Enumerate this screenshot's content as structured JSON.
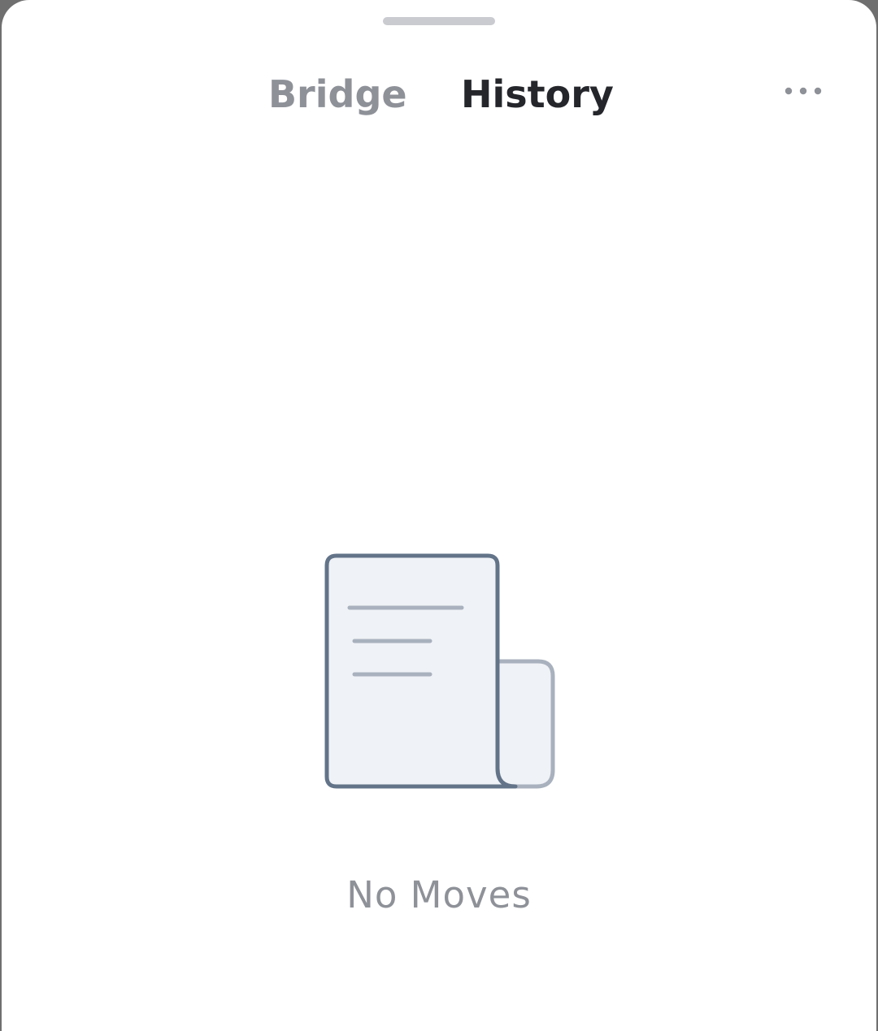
{
  "tabs": {
    "bridge_label": "Bridge",
    "history_label": "History",
    "active": "History"
  },
  "header": {
    "more_icon": "more-horizontal-icon"
  },
  "empty_state": {
    "icon": "receipt-document-icon",
    "message": "No Moves"
  },
  "colors": {
    "active_tab": "#24262b",
    "inactive_tab": "#8e9198",
    "icon_stroke": "#637489",
    "icon_fill": "#eff2f6",
    "icon_lines": "#a8b1bd"
  }
}
